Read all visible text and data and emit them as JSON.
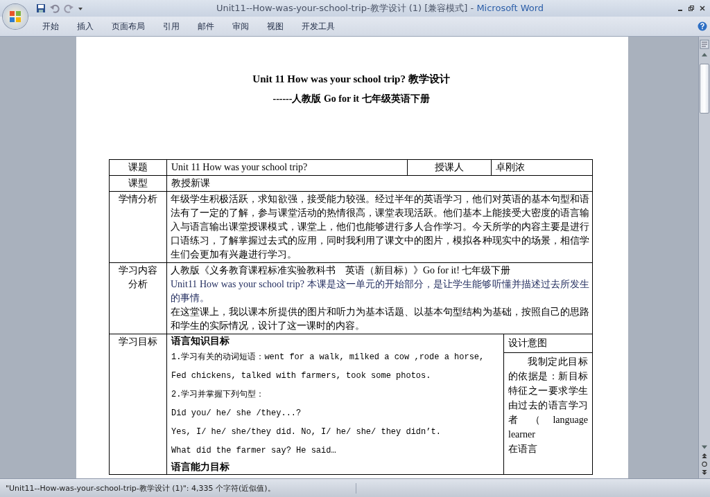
{
  "window": {
    "title": "Unit11--How-was-your-school-trip-教学设计 (1) [兼容模式]",
    "separator": "-",
    "app": "Microsoft Word"
  },
  "ribbon_tabs": [
    {
      "label": "开始"
    },
    {
      "label": "插入"
    },
    {
      "label": "页面布局"
    },
    {
      "label": "引用"
    },
    {
      "label": "邮件"
    },
    {
      "label": "审阅"
    },
    {
      "label": "视图"
    },
    {
      "label": "开发工具"
    }
  ],
  "document": {
    "title": "Unit 11 How was your school trip?  教学设计",
    "subtitle": "------人教版 Go for it 七年级英语下册",
    "table": {
      "row_1": [
        "课题",
        "Unit 11 How was your school trip?",
        "授课人",
        "卓刚浓"
      ],
      "row_2": [
        "课型",
        "教授新课"
      ],
      "row_3": {
        "label": "学情分析",
        "paragraphs": [
          "年级学生积极活跃，求知欲强，接受能力较强。经过半年的英语学习，他们对英语的基本句型和语法有了一定的了解，参与课堂活动的热情很高，课堂表现活跃。他们基本上能接受大密度的语言输入与语言输出课堂授课模式，课堂上，他们也能够进行多人合作学习。今天所学的内容主要是进行口语练习，了解掌握过去式的应用，同时我利用了课文中的图片，模拟各种现实中的场景，相信学生们会更加有兴趣进行学习。"
        ]
      },
      "row_4": {
        "label": "学习内容分析",
        "paragraphs": [
          "人教版《义务教育课程标准实验教科书　英语（新目标）》Go for it!  七年级下册",
          "Unit11 How was your school trip?  本课是这一单元的开始部分，是让学生能够听懂并描述过去所发生的事情。",
          "在这堂课上，我以课本所提供的图片和听力为基本话题、以基本句型结构为基础，按照自己的思路和学生的实际情况，设计了这一课时的内容。"
        ]
      },
      "row_5": {
        "label": "学习目标",
        "content": [
          {
            "kind": "heading",
            "text": "语言知识目标"
          },
          {
            "kind": "line",
            "text": "1.学习有关的动词短语：went for a walk, milked a cow ,rode a horse,"
          },
          {
            "kind": "line",
            "text": "Fed chickens, talked with farmers, took some photos."
          },
          {
            "kind": "line",
            "text": "2.学习并掌握下列句型："
          },
          {
            "kind": "line",
            "text": "Did you/ he/ she /they...?"
          },
          {
            "kind": "line",
            "text": "Yes, I/ he/ she/they did.   No, I/ he/ she/ they didn’t."
          },
          {
            "kind": "line",
            "text": "What did the farmer say? He said…"
          },
          {
            "kind": "heading",
            "text": "语言能力目标"
          }
        ],
        "note_heading": "设计意图",
        "note_lines": [
          "我制定此目标的依据是：新目标特征之一要求学生由过去的语言学习者 （ language learner",
          "在语言"
        ]
      }
    }
  },
  "status_bar": {
    "text": "\"Unit11--How-was-your-school-trip-教学设计 (1)\": 4,335 个字符(近似值)。"
  }
}
